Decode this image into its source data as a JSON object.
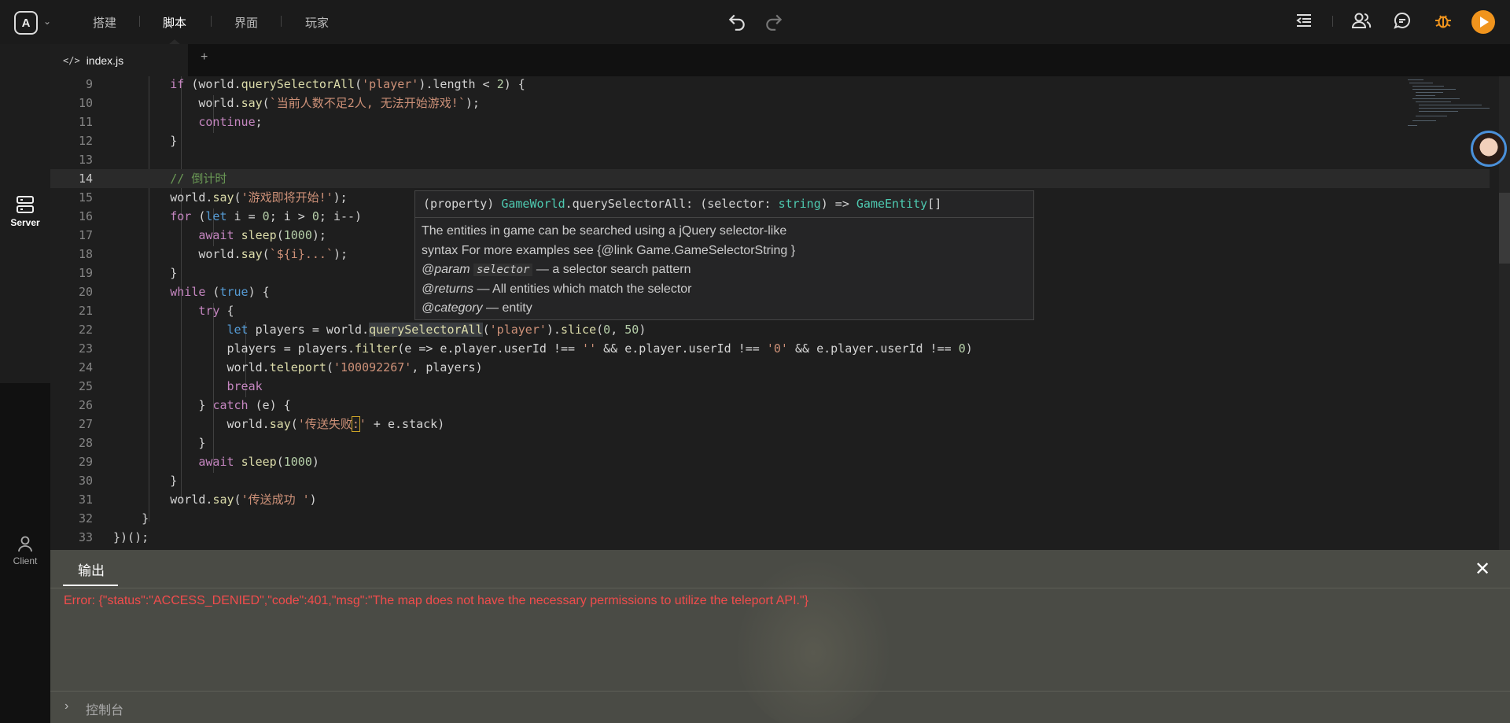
{
  "topbar": {
    "logo": "A",
    "tabs": [
      {
        "label": "搭建"
      },
      {
        "label": "脚本"
      },
      {
        "label": "界面"
      },
      {
        "label": "玩家"
      }
    ],
    "icons": [
      "undo-icon",
      "redo-icon",
      "outdent-icon",
      "users-icon",
      "chat-icon",
      "bug-icon",
      "play-icon"
    ],
    "colors": {
      "accent": "#f0941d",
      "bug": "#f0941d"
    }
  },
  "sidebar": {
    "server_label": "Server",
    "client_label": "Client"
  },
  "editor": {
    "tab_label": "index.js",
    "tab_icon": "</>",
    "add_label": "+",
    "lines": [
      {
        "n": "9"
      },
      {
        "n": "10"
      },
      {
        "n": "11"
      },
      {
        "n": "12"
      },
      {
        "n": "13"
      },
      {
        "n": "14"
      },
      {
        "n": "15"
      },
      {
        "n": "16"
      },
      {
        "n": "17"
      },
      {
        "n": "18"
      },
      {
        "n": "19"
      },
      {
        "n": "20"
      },
      {
        "n": "21"
      },
      {
        "n": "22"
      },
      {
        "n": "23"
      },
      {
        "n": "24"
      },
      {
        "n": "25"
      },
      {
        "n": "26"
      },
      {
        "n": "27"
      },
      {
        "n": "28"
      },
      {
        "n": "29"
      },
      {
        "n": "30"
      },
      {
        "n": "31"
      },
      {
        "n": "32"
      },
      {
        "n": "33"
      }
    ],
    "current_line": "14"
  },
  "tooltip": {
    "sig_prefix": "(property) ",
    "sig_type": "GameWorld",
    "sig_member": ".querySelectorAll: (selector: ",
    "sig_string": "string",
    "sig_arrow": ") => ",
    "sig_ret": "GameEntity",
    "sig_end": "[]",
    "desc1": "The entities in game can be searched using a jQuery selector-like",
    "desc2": "syntax For more examples see {@link Game.GameSelectorString }",
    "param_tag": "@param",
    "param_name": "selector",
    "param_desc": " — a selector search pattern",
    "returns_tag": "@returns",
    "returns_desc": " — All entities which match the selector",
    "category_tag": "@category",
    "category_desc": " — entity"
  },
  "output": {
    "title": "输出",
    "error": "Error: {\"status\":\"ACCESS_DENIED\",\"code\":401,\"msg\":\"The map does not have the necessary permissions to utilize the teleport API.\"}",
    "console_label": "控制台",
    "close_label": "✕",
    "console_caret": "›",
    "colors": {
      "error": "#f14c4c"
    }
  }
}
